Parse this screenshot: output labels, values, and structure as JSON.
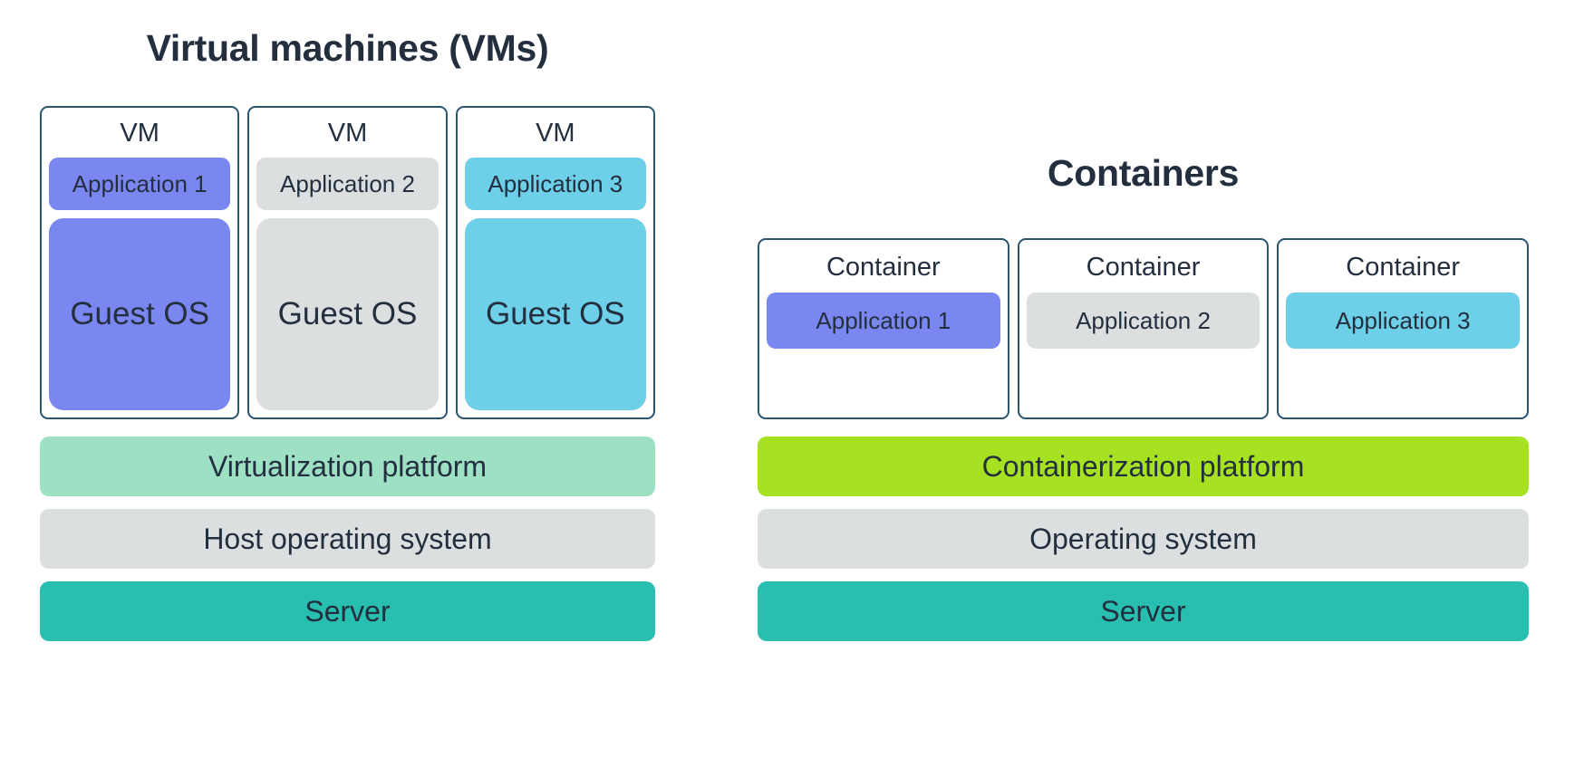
{
  "palette": {
    "background": "#ffffff",
    "text_dark": "#232f3e",
    "card_border": "#2a5571",
    "app1_purple": "#7b87f0",
    "app2_gray": "#dcdfdf",
    "app3_cyan": "#6ecfe8",
    "virtualization_mint": "#9ee0c4",
    "containerization_green": "#a6e122",
    "os_gray": "#dcdfdf",
    "server_teal": "#29bfb0"
  },
  "vms": {
    "title": "Virtual machines (VMs)",
    "cards": [
      {
        "header": "VM",
        "app": "Application 1",
        "app_color": "#7b87f0",
        "os": "Guest OS",
        "os_color": "#7b87f0"
      },
      {
        "header": "VM",
        "app": "Application 2",
        "app_color": "#dcdfdf",
        "os": "Guest OS",
        "os_color": "#dcdfdf"
      },
      {
        "header": "VM",
        "app": "Application 3",
        "app_color": "#6ecfe8",
        "os": "Guest OS",
        "os_color": "#6ecfe8"
      }
    ],
    "layers": [
      {
        "label": "Virtualization platform",
        "color": "#9ee0c4"
      },
      {
        "label": "Host operating system",
        "color": "#dcdfdf"
      },
      {
        "label": "Server",
        "color": "#29bfb0"
      }
    ]
  },
  "containers": {
    "title": "Containers",
    "cards": [
      {
        "header": "Container",
        "app": "Application 1",
        "app_color": "#7b87f0"
      },
      {
        "header": "Container",
        "app": "Application 2",
        "app_color": "#dcdfdf"
      },
      {
        "header": "Container",
        "app": "Application 3",
        "app_color": "#6ecfe8"
      }
    ],
    "layers": [
      {
        "label": "Containerization platform",
        "color": "#a6e122"
      },
      {
        "label": "Operating system",
        "color": "#dcdfdf"
      },
      {
        "label": "Server",
        "color": "#29bfb0"
      }
    ]
  }
}
